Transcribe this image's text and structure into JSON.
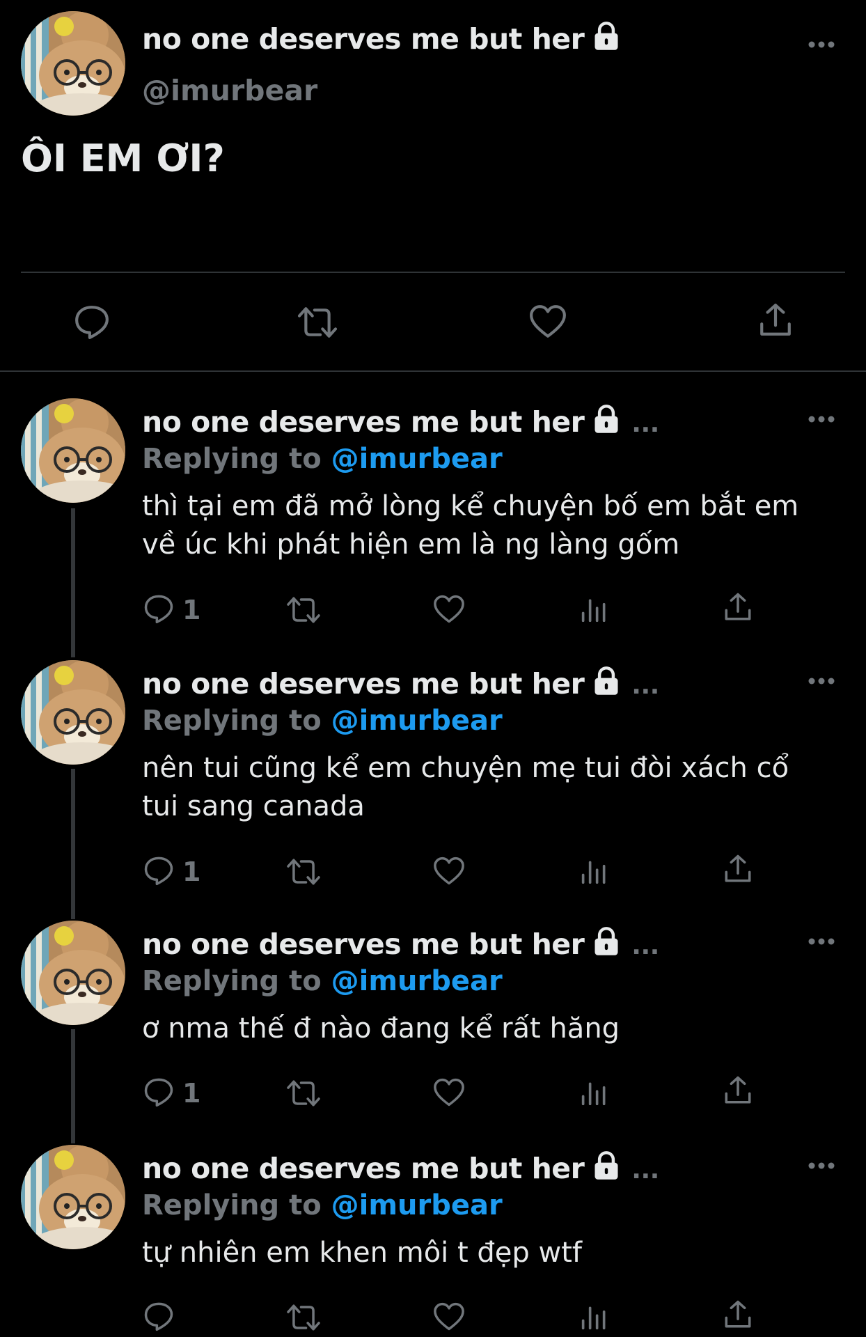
{
  "main_tweet": {
    "display_name": "no one deserves me but her",
    "handle": "@imurbear",
    "text": "ÔI EM ƠI?",
    "lock_icon": "lock-icon",
    "actions": [
      "reply-icon",
      "retweet-icon",
      "like-icon",
      "share-icon"
    ]
  },
  "replies": [
    {
      "display_name": "no one deserves me but her",
      "trailing": "...",
      "replying_prefix": "Replying to",
      "replying_handle": "@imurbear",
      "text": "thì tại em đã mở lòng kể chuyện bố em bắt em về úc khi phát hiện em là ng làng gốm",
      "reply_count": "1"
    },
    {
      "display_name": "no one deserves me but her",
      "trailing": "...",
      "replying_prefix": "Replying to",
      "replying_handle": "@imurbear",
      "text": "nên tui cũng kể em chuyện mẹ tui đòi xách cổ tui sang canada",
      "reply_count": "1"
    },
    {
      "display_name": "no one deserves me but her",
      "trailing": "...",
      "replying_prefix": "Replying to",
      "replying_handle": "@imurbear",
      "text": "ơ nma thế đ nào đang kể rất hăng",
      "reply_count": "1"
    },
    {
      "display_name": "no one deserves me but her",
      "trailing": "...",
      "replying_prefix": "Replying to",
      "replying_handle": "@imurbear",
      "text": "tự nhiên em khen môi t đẹp wtf",
      "reply_count": ""
    }
  ],
  "colors": {
    "background": "#000000",
    "text": "#e7e9ea",
    "muted": "#71767b",
    "link": "#1d9bf0"
  }
}
